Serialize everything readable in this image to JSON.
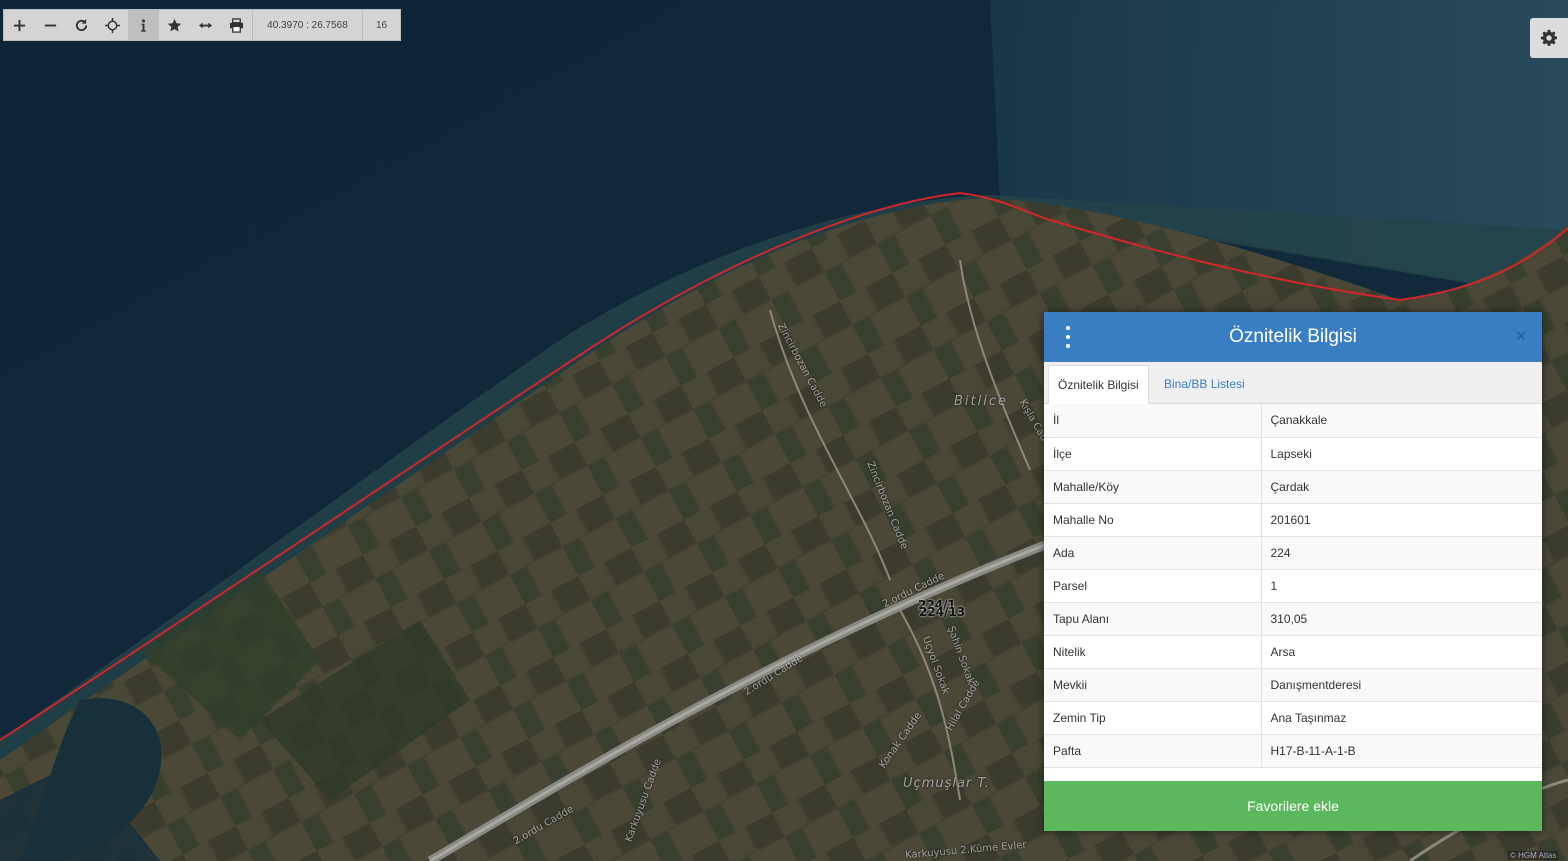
{
  "toolbar": {
    "coords": "40.3970 : 26.7568",
    "zoom": "16"
  },
  "map_labels": {
    "bitlice": "Bitlice",
    "ucmuslar": "Uçmuşlar T.",
    "parcel_a": "224/1",
    "parcel_b": "224/13",
    "road_1": "2.ordu Cadde",
    "road_2": "2.ordu Cadde",
    "road_3": "2.ordu Cadde",
    "street_1": "Zincirbozan Cadde",
    "street_2": "Zincirbozan Cadde",
    "street_3": "Karkuyusu Cadde",
    "street_4": "Konak Cadde",
    "street_5": "Hilal Cadde",
    "street_6": "Şahin Sokak",
    "street_7": "Uçyol Sokak",
    "street_8": "Karkuyusu 2.Küme Evler",
    "street_9": "Kışla Cad"
  },
  "attribution": "© HGM Atlas",
  "panel": {
    "title": "Öznitelik Bilgisi",
    "close": "×",
    "tabs": [
      "Öznitelik Bilgisi",
      "Bina/BB Listesi"
    ],
    "rows": [
      {
        "key": "İl",
        "value": "Çanakkale"
      },
      {
        "key": "İlçe",
        "value": "Lapseki"
      },
      {
        "key": "Mahalle/Köy",
        "value": "Çardak"
      },
      {
        "key": "Mahalle No",
        "value": "201601"
      },
      {
        "key": "Ada",
        "value": "224"
      },
      {
        "key": "Parsel",
        "value": "1"
      },
      {
        "key": "Tapu Alanı",
        "value": "310,05"
      },
      {
        "key": "Nitelik",
        "value": "Arsa"
      },
      {
        "key": "Mevkii",
        "value": "Danışmentderesi"
      },
      {
        "key": "Zemin Tip",
        "value": "Ana Taşınmaz"
      },
      {
        "key": "Pafta",
        "value": "H17-B-11-A-1-B"
      }
    ],
    "favorite_button": "Favorilere ekle"
  },
  "colors": {
    "header": "#3a7fc3",
    "favorite": "#5cb85c",
    "boundary": "#d0262b"
  },
  "icons": {
    "toolbar": [
      "plus-icon",
      "minus-icon",
      "refresh-icon",
      "crosshair-icon",
      "info-icon",
      "star-icon",
      "measure-icon",
      "print-icon"
    ],
    "settings": "gear-icon",
    "panel_menu": "vertical-dots-icon"
  }
}
